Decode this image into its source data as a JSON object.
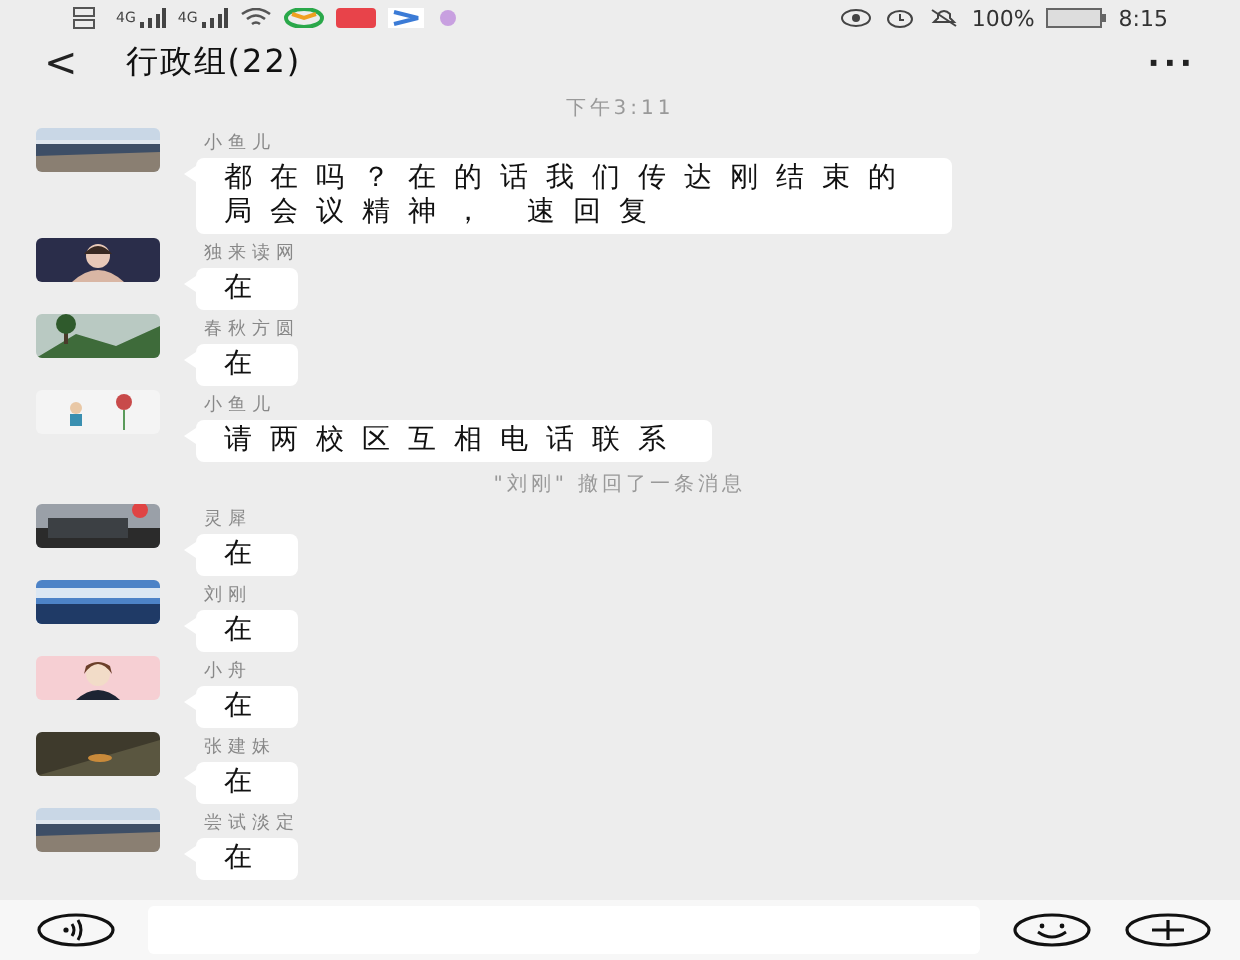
{
  "status_bar": {
    "network": [
      "4G",
      "4G"
    ],
    "battery": "100%",
    "time": "8:15"
  },
  "header": {
    "back": "<",
    "title": "行政组(22)",
    "more": "···"
  },
  "messages": [
    {
      "kind": "time",
      "text": "下午3:11"
    },
    {
      "kind": "message",
      "sender": "小鱼儿",
      "text": "都在吗？在的话我们传达刚结束的局会议精神， 速回复"
    },
    {
      "kind": "message",
      "sender": "独来读网",
      "text": "在"
    },
    {
      "kind": "message",
      "sender": "春秋方圆",
      "text": "在"
    },
    {
      "kind": "message",
      "sender": "小鱼儿",
      "text": "请两校区互相电话联系"
    },
    {
      "kind": "system",
      "text": "\"刘刚\" 撤回了一条消息"
    },
    {
      "kind": "message",
      "sender": "灵犀",
      "text": "在"
    },
    {
      "kind": "message",
      "sender": "刘刚",
      "text": "在"
    },
    {
      "kind": "message",
      "sender": "小舟",
      "text": "在"
    },
    {
      "kind": "message",
      "sender": "张建妹",
      "text": "在"
    },
    {
      "kind": "message",
      "sender": "尝试淡定",
      "text": "在"
    }
  ]
}
